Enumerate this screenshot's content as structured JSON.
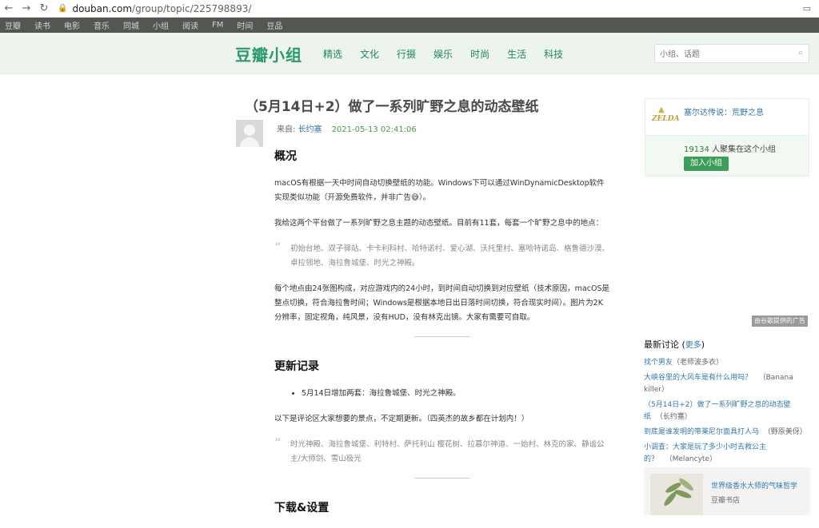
{
  "browser": {
    "url_host": "douban.com",
    "url_path": "/group/topic/225798893/",
    "back_icon": "arrow-left-icon",
    "forward_icon": "arrow-right-icon",
    "reload_icon": "reload-icon"
  },
  "global_nav": [
    "豆瓣",
    "读书",
    "电影",
    "音乐",
    "同城",
    "小组",
    "阅读",
    "FM",
    "时间",
    "豆品"
  ],
  "header": {
    "logo": "豆瓣小组",
    "nav": [
      "精选",
      "文化",
      "行摄",
      "娱乐",
      "时尚",
      "生活",
      "科技"
    ],
    "search_placeholder": "小组、话题"
  },
  "topic": {
    "title": "（5月14日+2）做了一系列旷野之息的动态壁纸",
    "from_label": "来自: ",
    "author": "长约塞",
    "time": "2021-05-13 02:41:06"
  },
  "article": {
    "h_overview": "概况",
    "p1": "macOS有根据一天中时间自动切换壁纸的功能。Windows下可以通过WinDynamicDesktop软件实现类似功能（开源免费软件，并非广告😅）。",
    "p2": "我给这两个平台做了一系列旷野之息主题的动态壁纸。目前有11套，每套一个旷野之息中的地点：",
    "quote1": "初始台地、双子驿站、卡卡利科村、哈特诺村、爱心湖、沃托里村、塞哈特诺岛、格鲁德沙漠、卓拉领地、海拉鲁城堡、时光之神殿。",
    "p3": "每个地点由24张图构成，对应游戏内的24小时，到时间自动切换到对应壁纸（技术原因，macOS是整点切换，符合海拉鲁时间；Windows是根据本地日出日落时间切换，符合现实时间）。图片为2K分辨率，固定视角，纯风景，没有HUD，没有林克出镜。大家有需要可自取。",
    "h_updates": "更新记录",
    "update_item": "5月14日增加两套：海拉鲁城堡、时光之神殿。",
    "p4": "以下是评论区大家想要的景点，不定期更新。（四英杰的故乡都在计划内！）",
    "quote2": "时光神殿、海拉鲁城堡、利特村、萨托利山 樱花树、拉慕尔神道、一始村、林克的家、静谧公主/大师剑、雪山极光",
    "h_download": "下载&设置"
  },
  "sidebar": {
    "group_name": "塞尔达传说：荒野之息",
    "members_count": "19134",
    "members_text": " 人聚集在这个小组",
    "join_label": "加入小组",
    "logo_text": "ZELDA",
    "ad_label": "由谷歌提供的广告",
    "latest_title": "最新讨论",
    "latest_more": "更多",
    "discussions": [
      {
        "title": "找个男友",
        "author": "（老师波多衣）"
      },
      {
        "title": "大峡谷里的大风车是有什么用吗？",
        "author": "（Banana killer）"
      },
      {
        "title": "（5月14日+2）做了一系列旷野之息的动态壁纸",
        "author": "（长约塞）"
      },
      {
        "title": "到底是谁发明的带莱尼尔面具打人马",
        "author": "（野原美伢）"
      },
      {
        "title": "小调查：大家是玩了多少小时去救公主的？",
        "author": "（Melancyte）"
      }
    ],
    "book_title": "世界级香水大师的气味哲学",
    "book_source": "豆瓣书店"
  }
}
